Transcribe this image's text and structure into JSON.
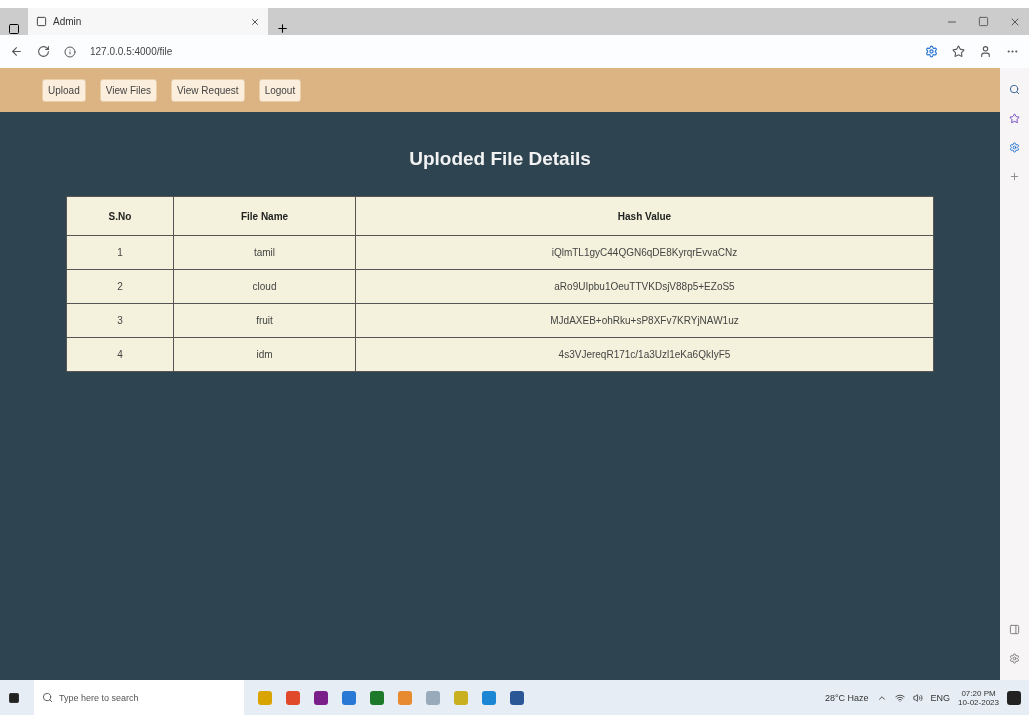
{
  "browser": {
    "tab_title": "Admin",
    "address": "127.0.0.5:4000/file"
  },
  "nav": [
    "Upload",
    "View Files",
    "View Request",
    "Logout"
  ],
  "page_title": "Uploded File Details",
  "table": {
    "columns": [
      "S.No",
      "File Name",
      "Hash Value"
    ],
    "rows": [
      [
        "1",
        "tamil",
        "iQlmTL1gyC44QGN6qDE8KyrqrEvvaCNz"
      ],
      [
        "2",
        "cloud",
        "aRo9UIpbu1OeuTTVKDsjV88p5+EZoS5"
      ],
      [
        "3",
        "fruit",
        "MJdAXEB+ohRku+sP8XFv7KRYjNAW1uz"
      ],
      [
        "4",
        "idm",
        "4s3VJereqR171c/1a3Uzl1eKa6QkIyF5"
      ]
    ]
  },
  "taskbar": {
    "search_placeholder": "Type here to search",
    "weather": "28°C Haze",
    "language": "ENG",
    "time": "07:20 PM",
    "date": "10-02-2023"
  }
}
